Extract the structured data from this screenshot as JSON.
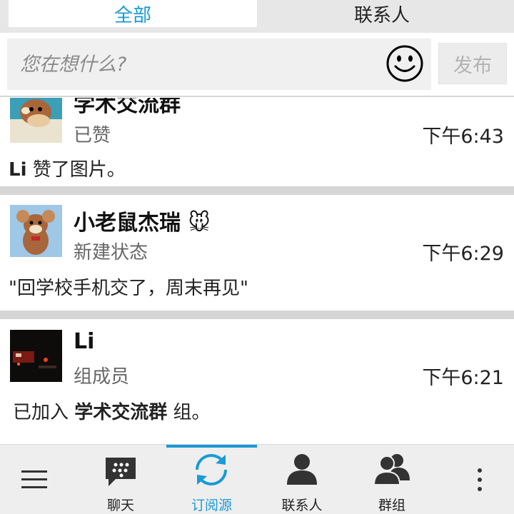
{
  "tabs": {
    "all": "全部",
    "contacts": "联系人"
  },
  "composer": {
    "placeholder": "您在想什么?",
    "publish": "发布",
    "emoji_icon": "smiley-icon"
  },
  "feed": [
    {
      "author": "学术交流群",
      "action": "已赞",
      "time": "下午6:43",
      "body_bold": "Li",
      "body_text": " 赞了图片。"
    },
    {
      "author": "小老鼠杰瑞",
      "author_emoji": "🐭",
      "action": "新建状态",
      "time": "下午6:29",
      "body_text": "\"回学校手机交了，周末再见\""
    },
    {
      "author": "Li",
      "action": "组成员",
      "time": "下午6:21",
      "body_prefix": "已加入 ",
      "body_bold": "学术交流群",
      "body_suffix": " 组。"
    }
  ],
  "nav": [
    {
      "label": "",
      "icon": "menu-icon"
    },
    {
      "label": "聊天",
      "icon": "chat-icon"
    },
    {
      "label": "订阅源",
      "icon": "feeds-sync-icon",
      "active": true
    },
    {
      "label": "联系人",
      "icon": "contact-icon"
    },
    {
      "label": "群组",
      "icon": "groups-icon"
    },
    {
      "label": "",
      "icon": "overflow-icon"
    }
  ],
  "colors": {
    "accent": "#1a9ad6",
    "separator": "#d6d6d6",
    "nav_bg": "#eeeeee"
  }
}
